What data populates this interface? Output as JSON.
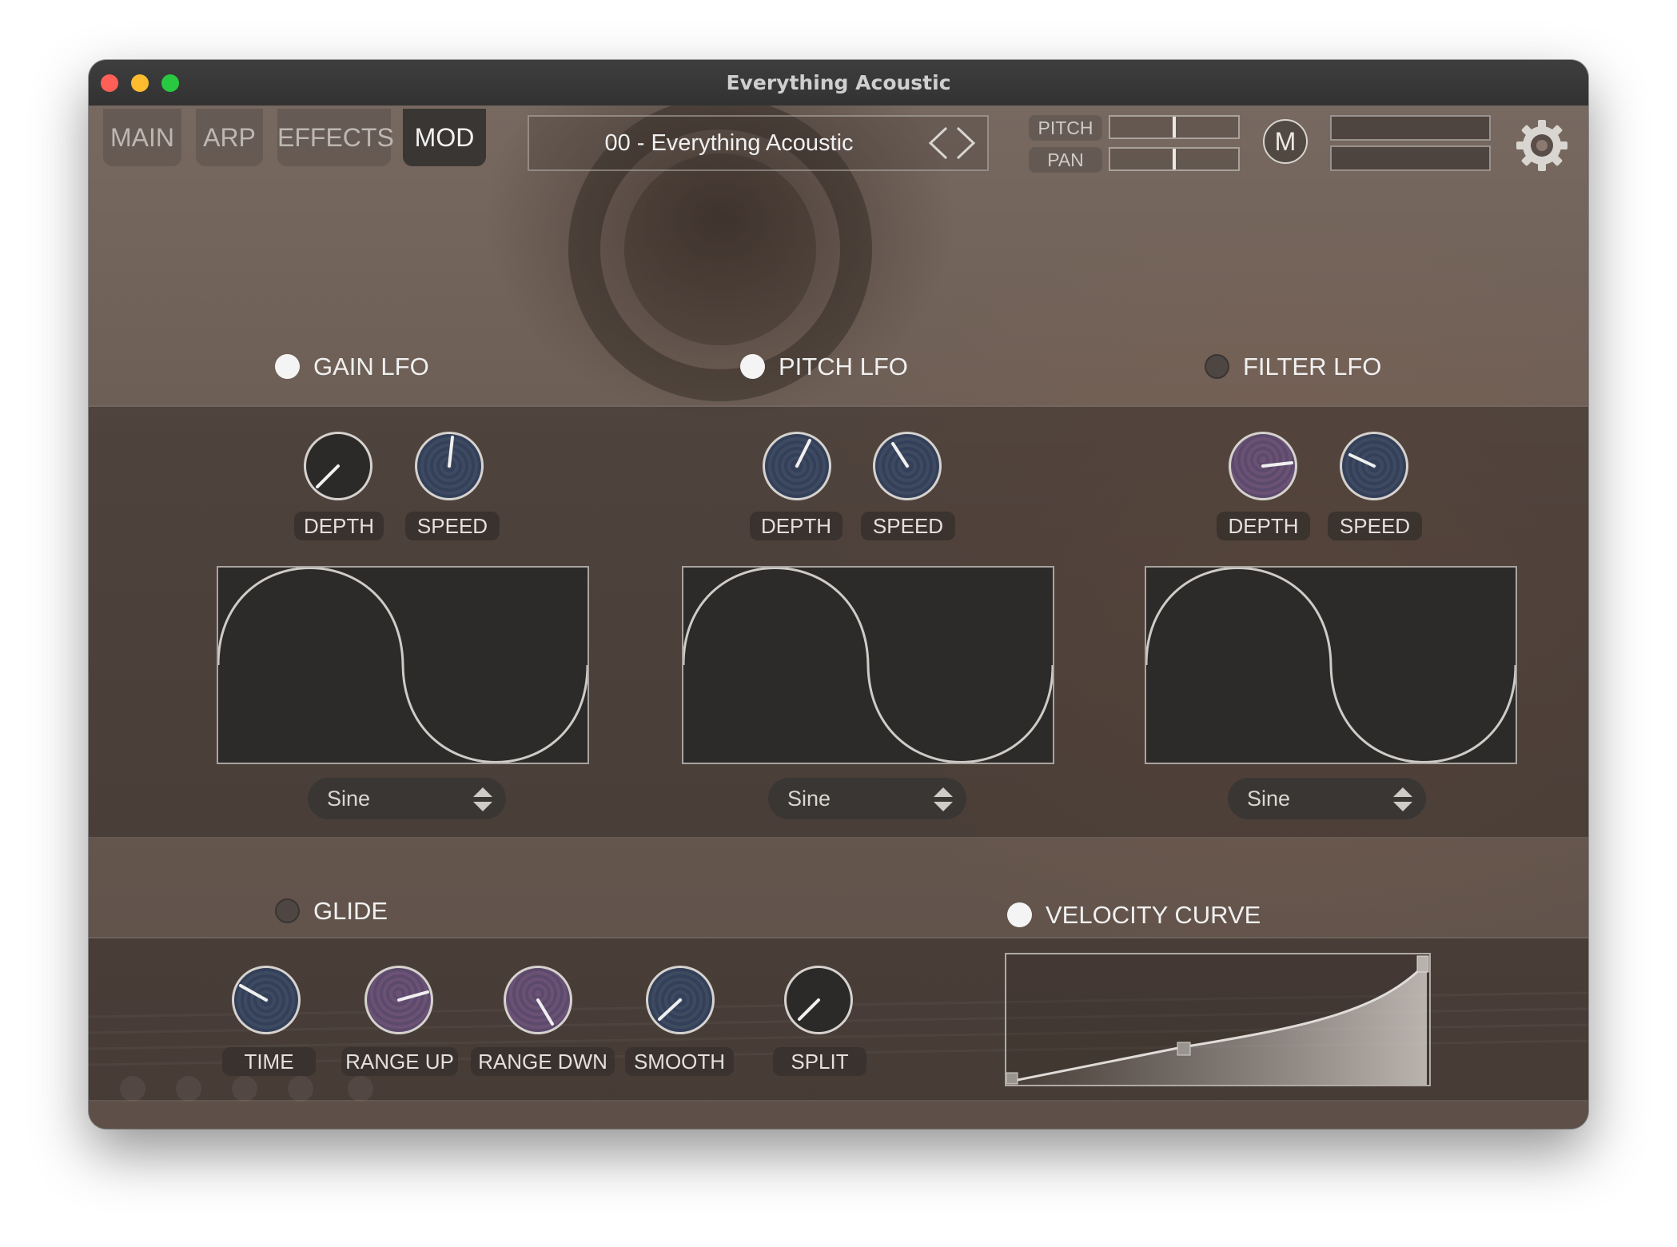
{
  "window": {
    "title": "Everything Acoustic"
  },
  "tabs": [
    {
      "label": "MAIN"
    },
    {
      "label": "ARP"
    },
    {
      "label": "EFFECTS"
    },
    {
      "label": "MOD",
      "active": true
    }
  ],
  "preset": {
    "name": "00 - Everything Acoustic"
  },
  "header_controls": {
    "pitch_label": "PITCH",
    "pan_label": "PAN",
    "m_button_label": "M"
  },
  "lfos": [
    {
      "title": "GAIN LFO",
      "enabled": true,
      "depth_label": "DEPTH",
      "speed_label": "SPEED",
      "waveform": "Sine"
    },
    {
      "title": "PITCH LFO",
      "enabled": true,
      "depth_label": "DEPTH",
      "speed_label": "SPEED",
      "waveform": "Sine"
    },
    {
      "title": "FILTER LFO",
      "enabled": false,
      "depth_label": "DEPTH",
      "speed_label": "SPEED",
      "waveform": "Sine"
    }
  ],
  "glide": {
    "title": "GLIDE",
    "enabled": false,
    "knobs": [
      {
        "label": "TIME"
      },
      {
        "label": "RANGE UP"
      },
      {
        "label": "RANGE DWN"
      },
      {
        "label": "SMOOTH"
      },
      {
        "label": "SPLIT"
      }
    ]
  },
  "velocity_curve": {
    "title": "VELOCITY CURVE",
    "enabled": true
  },
  "icons": {
    "close": "close-dot-icon",
    "minimize": "minimize-dot-icon",
    "zoom": "zoom-dot-icon",
    "preset_prev": "chevron-left-icon",
    "preset_next": "chevron-right-icon",
    "settings": "gear-icon",
    "select_arrows": "up-down-arrows-icon"
  },
  "colors": {
    "close": "#fe5f57",
    "minimize": "#febc2e",
    "zoom": "#28c840",
    "knob_blue": "#3d4a60",
    "knob_purple": "#6b5275"
  }
}
